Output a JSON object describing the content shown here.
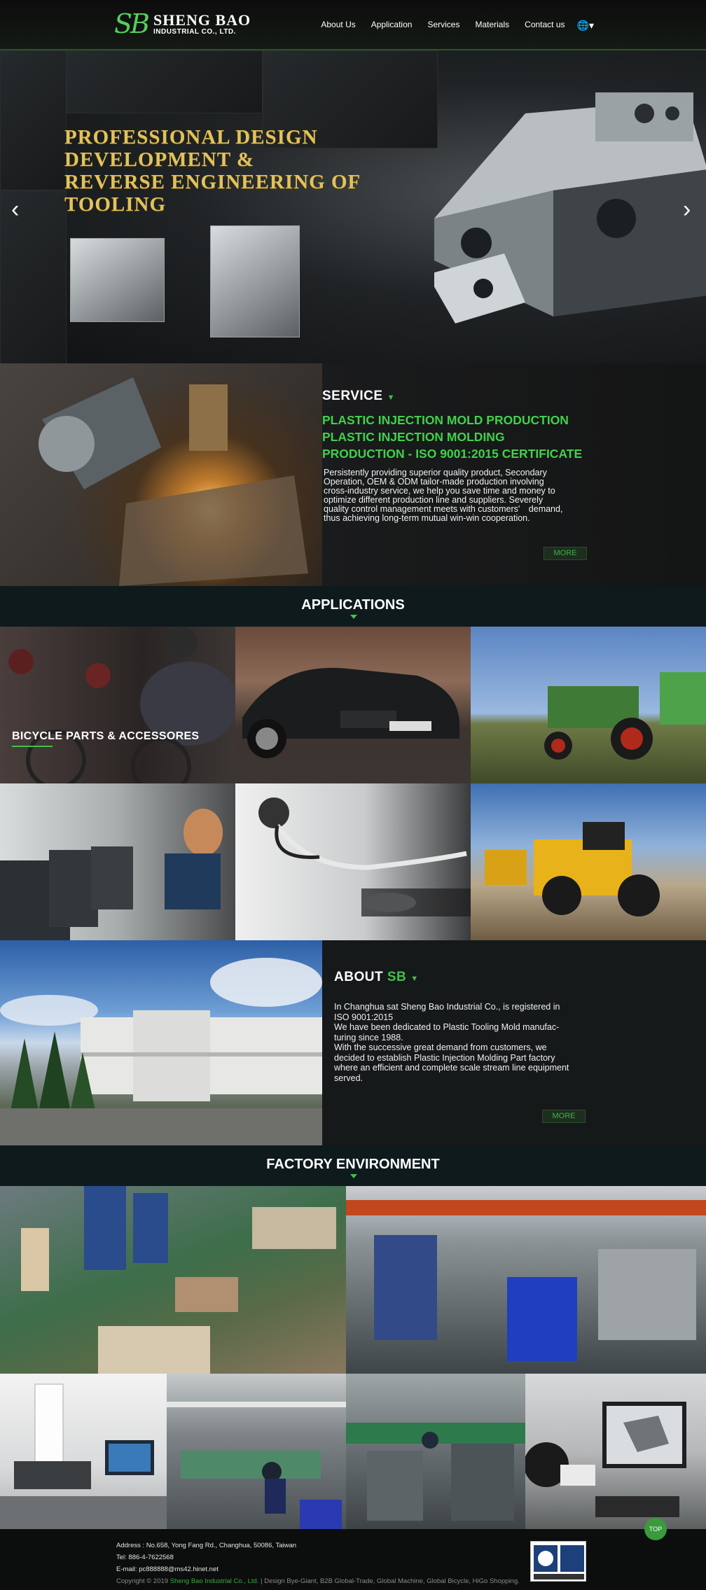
{
  "header": {
    "logo_mark": "SB",
    "logo_name": "SHENG BAO",
    "logo_sub": "INDUSTRIAL CO., LTD.",
    "nav": [
      "About Us",
      "Application",
      "Services",
      "Materials",
      "Contact us"
    ],
    "language_icon": "globe-icon"
  },
  "hero": {
    "title_lines": [
      "PROFESSIONAL DESIGN",
      "DEVELOPMENT &",
      "REVERSE ENGINEERING OF",
      "TOOLING"
    ],
    "prev_icon": "chevron-left-icon",
    "next_icon": "chevron-right-icon",
    "slides": 3,
    "active_slide": 2
  },
  "service": {
    "heading": "SERVICE",
    "subtitle_lines": [
      "PLASTIC INJECTION MOLD PRODUCTION",
      "PLASTIC INJECTION MOLDING",
      "PRODUCTION - ISO 9001:2015 CERTIFICATE"
    ],
    "body_lines": [
      "Persistently providing superior quality product, Secondary",
      "Operation, OEM & ODM tailor-made production involving",
      "cross-industry service, we help you save time and money to",
      "optimize different production line and suppliers. Severely",
      "quality control management meets with customers' demand,",
      "thus achieving long-term mutual win-win cooperation."
    ],
    "more": "MORE"
  },
  "applications": {
    "heading": "APPLICATIONS",
    "tiles": [
      {
        "label": "BICYCLE PARTS & ACCESSORES",
        "scene": "bicycle-racers"
      },
      {
        "label": "",
        "scene": "car"
      },
      {
        "label": "",
        "scene": "tractor"
      },
      {
        "label": "",
        "scene": "treadmill-fitness"
      },
      {
        "label": "",
        "scene": "stethoscope"
      },
      {
        "label": "",
        "scene": "wheel-loader"
      }
    ]
  },
  "about": {
    "heading": "ABOUT",
    "heading_accent": "SB",
    "body_lines": [
      "In Changhua sat Sheng Bao Industrial Co., is registered in",
      "ISO 9001:2015",
      "We have been dedicated to Plastic Tooling Mold manufac-",
      "turing since 1988.",
      "With the successive great demand from customers, we",
      "decided to establish Plastic Injection Molding Part factory",
      "where an efficient and complete scale stream line equipment",
      "served."
    ],
    "more": "MORE"
  },
  "factory": {
    "heading": "FACTORY ENVIRONMENT"
  },
  "footer": {
    "address": "Address : No.658, Yong Fang Rd., Changhua, 50086, Taiwan",
    "tel": "Tel: 886-4-7622568",
    "email": "E-mail: pc888888@ms42.hinet.net",
    "copyright_prefix": "Copyright ©  2019 ",
    "company_link": "Sheng Bao Industrial Co., Ltd.",
    "copyright_suffix": " | Design Bye-Giant, B2B Global-Trade, Global Machine, Global Bicycle, HiGo Shopping.",
    "top_label": "TOP"
  }
}
